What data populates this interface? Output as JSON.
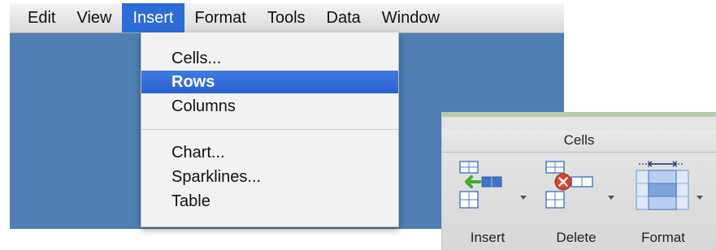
{
  "menubar": {
    "items": [
      "Edit",
      "View",
      "Insert",
      "Format",
      "Tools",
      "Data",
      "Window"
    ],
    "active": "Insert"
  },
  "insert_menu": {
    "items": [
      "Cells...",
      "Rows",
      "Columns",
      "Chart...",
      "Sparklines...",
      "Table"
    ],
    "highlighted": "Rows"
  },
  "cells_panel": {
    "title": "Cells",
    "buttons": {
      "insert": {
        "label": "Insert",
        "icon": "insert-cells-icon"
      },
      "delete": {
        "label": "Delete",
        "icon": "delete-cells-icon"
      },
      "format": {
        "label": "Format",
        "icon": "format-cells-icon"
      }
    }
  },
  "colors": {
    "workspace_blue": "#4f7fb4",
    "menu_highlight": "#2d6cd6",
    "insert_arrow_green": "#3cae2a",
    "delete_red": "#d8432d"
  }
}
